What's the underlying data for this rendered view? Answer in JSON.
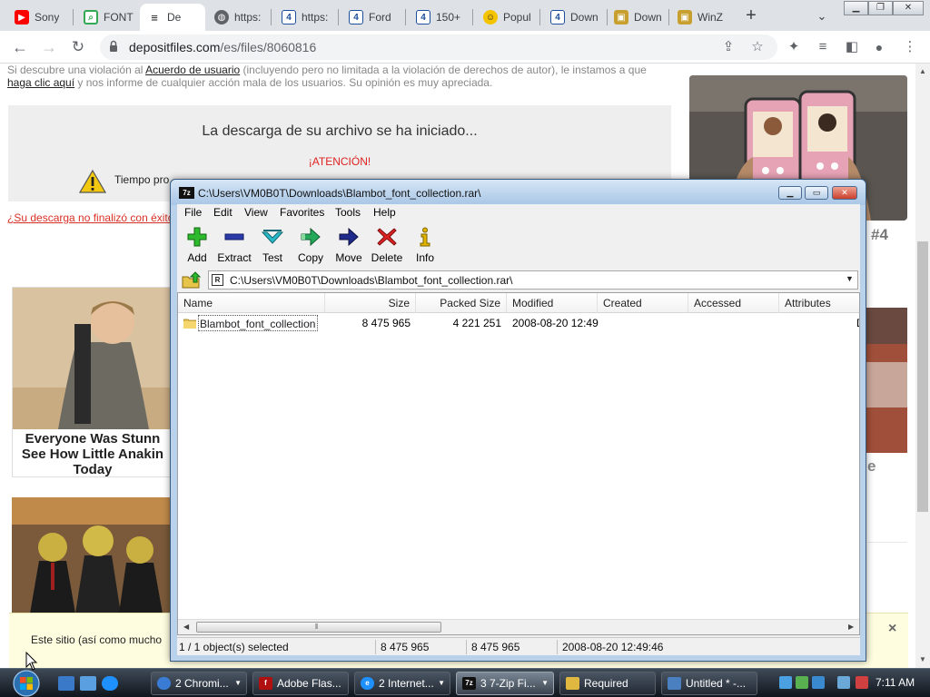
{
  "browser": {
    "tabs": [
      {
        "title": "Sony",
        "color": "#ff0000",
        "glyph": "▶"
      },
      {
        "title": "FONT",
        "color": "#34a853",
        "glyph": "⌕"
      },
      {
        "title": "De",
        "color": "#1a1a1a",
        "glyph": "≡"
      },
      {
        "title": "https:",
        "color": "#5f6368",
        "glyph": "◍"
      },
      {
        "title": "https:",
        "color": "#1c4e9c",
        "glyph": "4"
      },
      {
        "title": "Ford",
        "color": "#1c4e9c",
        "glyph": "4"
      },
      {
        "title": "150+",
        "color": "#1c4e9c",
        "glyph": "4"
      },
      {
        "title": "Popul",
        "color": "#f5c400",
        "glyph": "☺"
      },
      {
        "title": "Down",
        "color": "#1c4e9c",
        "glyph": "4"
      },
      {
        "title": "Down",
        "color": "#c8a030",
        "glyph": "▣"
      },
      {
        "title": "WinZ",
        "color": "#c8a030",
        "glyph": "▣"
      }
    ],
    "active_tab_index": 2,
    "url_host": "depositfiles.com",
    "url_path": "/es/files/8060816"
  },
  "page": {
    "notice_line1_pre": "Si descubre una violación al ",
    "notice_link1": "Acuerdo de usuario",
    "notice_line1_post": " (incluyendo pero no limitada a la violación de derechos de autor), le instamos a que",
    "notice_link2": "haga clic aquí",
    "notice_line2_post": " y nos informe de cualquier acción mala de los usuarios. Su opinión es muy apreciada.",
    "download_started": "La descarga de su archivo se ha iniciado...",
    "attention": "¡ATENCIÓN!",
    "tiempo": "Tiempo pro",
    "not_finished": "¿Su descarga no finalizó con éxito",
    "ad_left_caption": "Everyone Was Stunn See How Little Anakin Today",
    "ad_right_num": "#4",
    "ad_right_partial": "e",
    "cookie_text": "Este sitio (así como mucho",
    "cookie_close": "×"
  },
  "zip": {
    "title": "C:\\Users\\VM0B0T\\Downloads\\Blambot_font_collection.rar\\",
    "menu": [
      "File",
      "Edit",
      "View",
      "Favorites",
      "Tools",
      "Help"
    ],
    "toolbar": [
      "Add",
      "Extract",
      "Test",
      "Copy",
      "Move",
      "Delete",
      "Info"
    ],
    "path": "C:\\Users\\VM0B0T\\Downloads\\Blambot_font_collection.rar\\",
    "columns": [
      "Name",
      "Size",
      "Packed Size",
      "Modified",
      "Created",
      "Accessed",
      "Attributes"
    ],
    "rows": [
      {
        "name": "Blambot_font_collection",
        "size": "8 475 965",
        "packed": "4 221 251",
        "modified": "2008-08-20 12:49",
        "created": "",
        "accessed": "",
        "attr": "D"
      }
    ],
    "status": {
      "selected": "1 / 1 object(s) selected",
      "size": "8 475 965",
      "packed": "8 475 965",
      "modified": "2008-08-20 12:49:46"
    }
  },
  "taskbar": {
    "tasks": [
      "2 Chromi...",
      "Adobe Flas...",
      "2 Internet...",
      "3 7-Zip Fi...",
      "Required",
      "Untitled * -..."
    ],
    "active_task_index": 3,
    "clock": "7:11 AM"
  }
}
